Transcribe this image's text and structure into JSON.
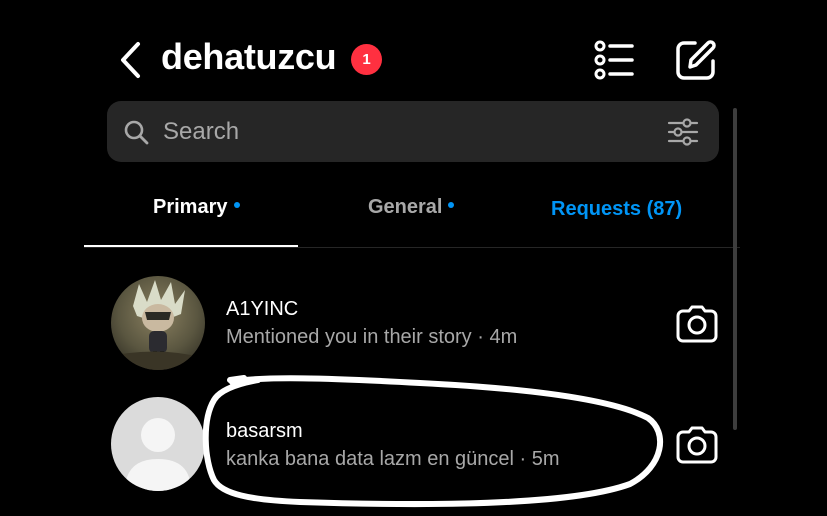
{
  "header": {
    "title": "dehatuzcu",
    "badge_count": "1",
    "icons": [
      "chevron-left-icon",
      "list-icon",
      "compose-icon"
    ]
  },
  "search": {
    "placeholder": "Search"
  },
  "tabs": [
    {
      "label": "Primary",
      "active": true,
      "has_dot": true
    },
    {
      "label": "General",
      "active": false,
      "has_dot": true
    },
    {
      "label": "Requests (87)",
      "active": false,
      "has_dot": false
    }
  ],
  "threads": [
    {
      "username": "A1YINC",
      "preview": "Mentioned you in their story · 4m"
    },
    {
      "username": "basarsm",
      "preview": "kanka bana data lazm en güncel · 5m"
    }
  ],
  "colors": {
    "background": "#000000",
    "search_bg": "#262626",
    "badge": "#ff3040",
    "accent_blue": "#0095f6",
    "secondary_text": "#a8a8a8",
    "annotation": "#ffffff"
  }
}
